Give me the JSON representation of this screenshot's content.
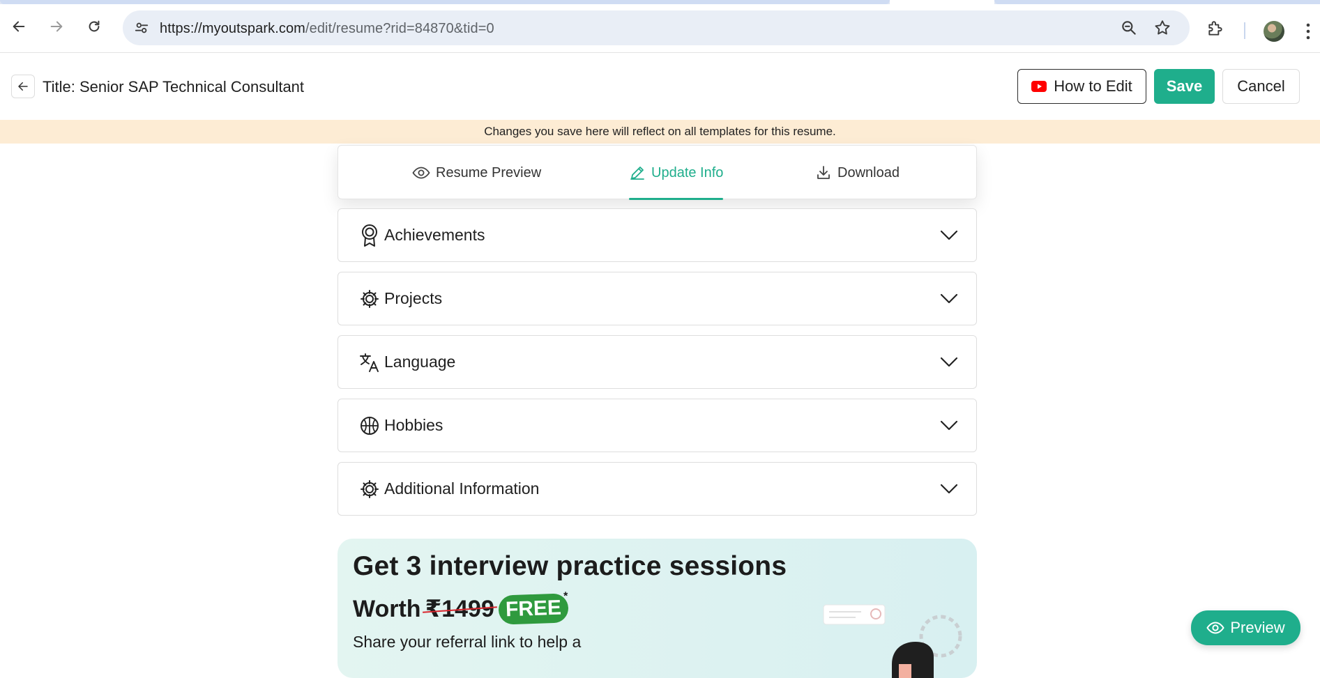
{
  "browser": {
    "url_host": "https://myoutspark.com",
    "url_path": "/edit/resume?rid=84870&tid=0"
  },
  "header": {
    "title": "Title: Senior SAP Technical Consultant",
    "how_to_edit": "How to Edit",
    "save": "Save",
    "cancel": "Cancel"
  },
  "notice": "Changes you save here will reflect on all templates for this resume.",
  "tabs": [
    {
      "label": "Resume Preview",
      "icon": "eye-icon"
    },
    {
      "label": "Update Info",
      "icon": "pencil-icon",
      "active": true
    },
    {
      "label": "Download",
      "icon": "download-icon"
    }
  ],
  "sections": [
    {
      "label": "Achievements",
      "icon": "award-icon"
    },
    {
      "label": "Projects",
      "icon": "gear-icon"
    },
    {
      "label": "Language",
      "icon": "translate-icon"
    },
    {
      "label": "Hobbies",
      "icon": "basketball-icon"
    },
    {
      "label": "Additional Information",
      "icon": "gear-icon"
    }
  ],
  "promo": {
    "headline": "Get 3 interview practice sessions",
    "worth_label": "Worth",
    "price": "₹1499",
    "free_badge": "FREE",
    "asterisk": "*",
    "share_text": "Share your referral link to help a"
  },
  "fab": {
    "label": "Preview"
  },
  "colors": {
    "accent": "#1fae8c",
    "notice_bg": "#fdecd4",
    "youtube_red": "#ff0000"
  }
}
